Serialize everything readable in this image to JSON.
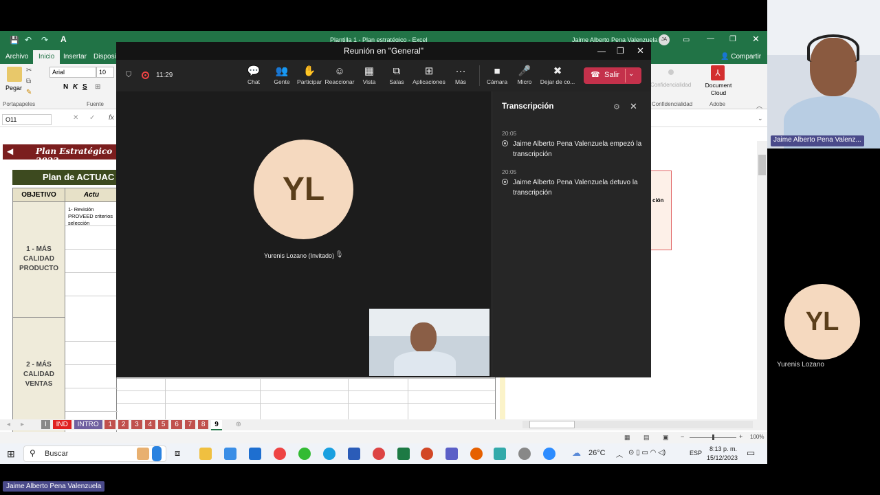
{
  "excel": {
    "title": "Plantilla 1 - Plan estratégico  -  Excel",
    "user": "Jaime Alberto Pena Valenzuela",
    "user_initials": "JA",
    "share_label": "Compartir",
    "tabs": [
      "Archivo",
      "Inicio",
      "Insertar",
      "Disposic"
    ],
    "ribbon": {
      "paste_label": "Pegar",
      "font_name": "Arial",
      "font_size": "10",
      "bold": "N",
      "italic": "K",
      "underline": "S",
      "group_clipboard": "Portapapeles",
      "group_font": "Fuente",
      "confidencialidad": "Confidencialidad",
      "confidencialidad_group": "Confidencialidad",
      "doc_cloud": "Document Cloud",
      "adobe_group": "Adobe"
    },
    "name_box": "O11",
    "fx": "fx",
    "sheet": {
      "banner": "Plan Estratégico 2023",
      "plan_title": "Plan de ACTUAC",
      "col_objetivo": "OBJETIVO",
      "col_actuacion": "Actu",
      "row1_label": "1 - MÁS CALIDAD PRODUCTO",
      "row1_text": "1- Revisión PROVEED criterios selección",
      "row2_label": "2 - MÁS CALIDAD VENTAS",
      "right_fragment": "ción"
    },
    "sheet_tabs": [
      "I",
      "IND",
      "INTRO",
      "1",
      "2",
      "3",
      "4",
      "5",
      "6",
      "7",
      "8",
      "9"
    ],
    "zoom": "100%"
  },
  "teams": {
    "title": "Reunión en \"General\"",
    "timer": "11:29",
    "toolbar": [
      {
        "label": "Chat",
        "icon": "chat-icon",
        "glyph": "💬"
      },
      {
        "label": "Gente",
        "icon": "people-icon",
        "glyph": "👥"
      },
      {
        "label": "Participar",
        "icon": "raise-hand-icon",
        "glyph": "✋"
      },
      {
        "label": "Reaccionar",
        "icon": "smile-icon",
        "glyph": "☺"
      },
      {
        "label": "Vista",
        "icon": "grid-icon",
        "glyph": "▦"
      },
      {
        "label": "Salas",
        "icon": "rooms-icon",
        "glyph": "⧉"
      },
      {
        "label": "Aplicaciones",
        "icon": "apps-icon",
        "glyph": "⊞"
      },
      {
        "label": "Más",
        "icon": "more-icon",
        "glyph": "···"
      }
    ],
    "media": [
      {
        "label": "Cámara",
        "icon": "camera-icon",
        "glyph": "■"
      },
      {
        "label": "Micro",
        "icon": "mic-icon",
        "glyph": "🎤"
      },
      {
        "label": "Dejar de co...",
        "icon": "stop-share-icon",
        "glyph": "✖"
      }
    ],
    "leave_label": "Salir",
    "participant": {
      "initials": "YL",
      "name": "Yurenis Lozano (Invitado)"
    },
    "transcript": {
      "title": "Transcripción",
      "entries": [
        {
          "time": "20:05",
          "text": "Jaime Alberto Pena Valenzuela empezó la transcripción"
        },
        {
          "time": "20:05",
          "text": "Jaime Alberto Pena Valenzuela detuvo la transcripción"
        }
      ]
    }
  },
  "side": {
    "cam_name": "Jaime Alberto Pena Valenz...",
    "yl_initials": "YL",
    "yl_name": "Yurenis Lozano"
  },
  "taskbar": {
    "search": "Buscar",
    "temp": "26°C",
    "lang": "ESP",
    "time": "8:13 p. m.",
    "date": "15/12/2023"
  },
  "bottom_name": "Jaime Alberto Pena Valenzuela",
  "colors": {
    "excel_green": "#217346",
    "teams_bg": "#1f1f1f",
    "leave_red": "#c4314b",
    "avatar": "#f5d9bf"
  }
}
